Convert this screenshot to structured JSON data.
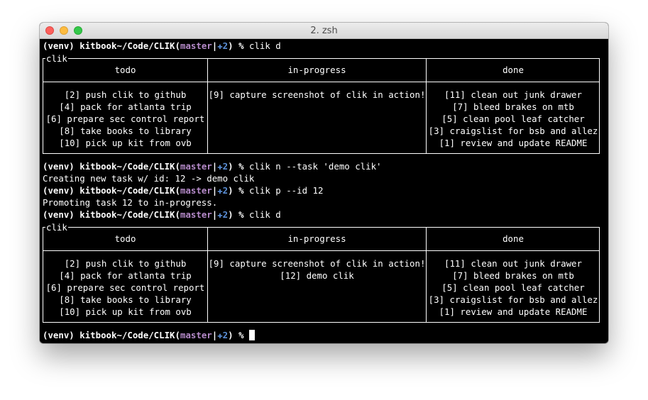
{
  "window": {
    "title": "2. zsh"
  },
  "prompt": {
    "venv": "(venv)",
    "host_path": "kitbook~/Code/CLIK(",
    "branch": "master",
    "sep": "|",
    "dirty_icon": "✚2",
    "close_paren": ")",
    "symbol": " %"
  },
  "session": {
    "cmd1": "clik d",
    "cmd2": "clik n --task 'demo clik'",
    "out2": "Creating new task w/ id: 12 -> demo clik",
    "cmd3": "clik p --id 12",
    "out3": "Promoting task 12 to in-progress.",
    "cmd4": "clik d",
    "cmd5": ""
  },
  "board_label": "clik",
  "columns": [
    "todo",
    "in-progress",
    "done"
  ],
  "board1": {
    "todo": [
      "[2] push clik to github",
      "[4] pack for atlanta trip",
      "[6] prepare sec control report",
      "[8] take books to library",
      "[10] pick up kit from ovb"
    ],
    "in_progress": [
      "[9] capture screenshot of clik in action!"
    ],
    "done": [
      "[11] clean out junk drawer",
      "[7] bleed brakes on mtb",
      "[5] clean pool leaf catcher",
      "[3] craigslist for bsb and allez",
      "[1] review and update README"
    ]
  },
  "board2": {
    "todo": [
      "[2] push clik to github",
      "[4] pack for atlanta trip",
      "[6] prepare sec control report",
      "[8] take books to library",
      "[10] pick up kit from ovb"
    ],
    "in_progress": [
      "[9] capture screenshot of clik in action!",
      "[12] demo clik"
    ],
    "done": [
      "[11] clean out junk drawer",
      "[7] bleed brakes on mtb",
      "[5] clean pool leaf catcher",
      "[3] craigslist for bsb and allez",
      "[1] review and update README"
    ]
  }
}
